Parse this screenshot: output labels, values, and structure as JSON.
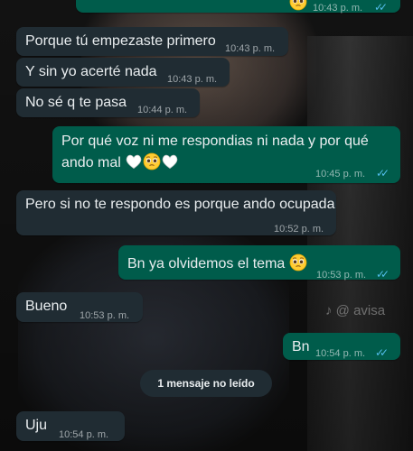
{
  "messages": [
    {
      "id": "m0",
      "dir": "out",
      "text": "",
      "time": "10:43 p. m.",
      "read": true,
      "emoji": "pleading"
    },
    {
      "id": "m1",
      "dir": "in",
      "text": "Porque tú empezaste primero",
      "time": "10:43 p. m."
    },
    {
      "id": "m2",
      "dir": "in",
      "text": "Y sin yo acerté nada",
      "time": "10:43 p. m."
    },
    {
      "id": "m3",
      "dir": "in",
      "text": "No sé q te pasa",
      "time": "10:44 p. m."
    },
    {
      "id": "m4",
      "dir": "out",
      "line1": "Por qué voz ni me respondias ni nada y por qué",
      "line2": "ando mal",
      "time": "10:45 p. m.",
      "read": true,
      "emojis": [
        "white-heart",
        "pleading",
        "white-heart"
      ]
    },
    {
      "id": "m5",
      "dir": "in",
      "text": "Pero si no te respondo es porque ando ocupada",
      "time": "10:52 p. m."
    },
    {
      "id": "m6",
      "dir": "out",
      "text": "Bn ya olvidemos el tema",
      "time": "10:53 p. m.",
      "read": true,
      "emoji": "pleading"
    },
    {
      "id": "m7",
      "dir": "in",
      "text": "Bueno",
      "time": "10:53 p. m."
    },
    {
      "id": "m8",
      "dir": "out",
      "text": "Bn",
      "time": "10:54 p. m.",
      "read": true
    },
    {
      "id": "m9",
      "dir": "in",
      "text": "Uju",
      "time": "10:54 p. m."
    }
  ],
  "unread_banner": "1 mensaje no leído",
  "watermark": "@ avisa",
  "colors": {
    "incoming": "#202c33",
    "outgoing": "#005c4b",
    "text": "#e9edef",
    "read_check": "#53bdeb"
  }
}
